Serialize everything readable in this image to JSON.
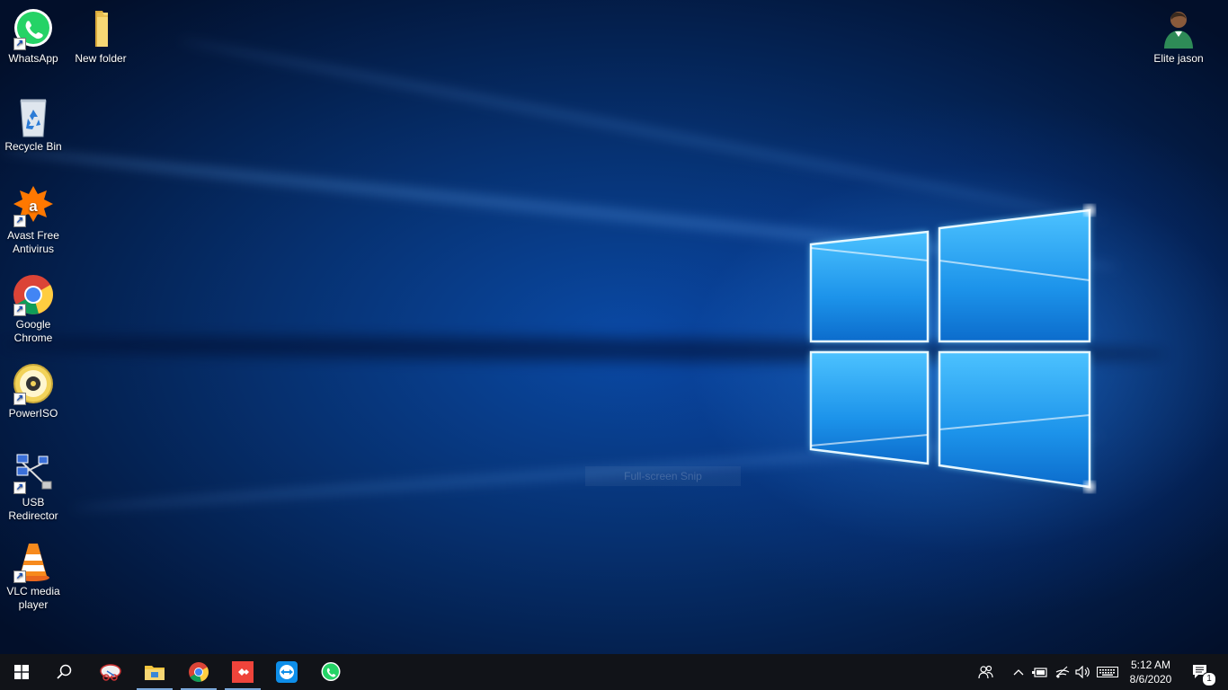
{
  "desktop": {
    "icons": [
      {
        "label": "WhatsApp",
        "icon": "whatsapp-icon"
      },
      {
        "label": "New folder",
        "icon": "folder-icon"
      },
      {
        "label": "Recycle Bin",
        "icon": "recycle-bin-icon"
      },
      {
        "label": "Avast Free Antivirus",
        "icon": "avast-icon"
      },
      {
        "label": "Google Chrome",
        "icon": "chrome-icon"
      },
      {
        "label": "PowerISO",
        "icon": "poweriso-icon"
      },
      {
        "label": "USB Redirector",
        "icon": "usb-redirector-icon"
      },
      {
        "label": "VLC media player",
        "icon": "vlc-icon"
      },
      {
        "label": "Elite jason",
        "icon": "user-folder-icon"
      }
    ],
    "overlay_text": "Full-screen Snip"
  },
  "taskbar": {
    "pinned": [
      "start",
      "search",
      "snipping-tool",
      "file-explorer",
      "chrome",
      "anydesk",
      "teamviewer",
      "whatsapp"
    ],
    "clock": {
      "time": "5:12 AM",
      "date": "8/6/2020"
    },
    "notification_count": "1"
  },
  "colors": {
    "taskbar_bg": "#111318",
    "accent": "#0078d7",
    "wallpaper_glow": "#3cb6ff"
  }
}
